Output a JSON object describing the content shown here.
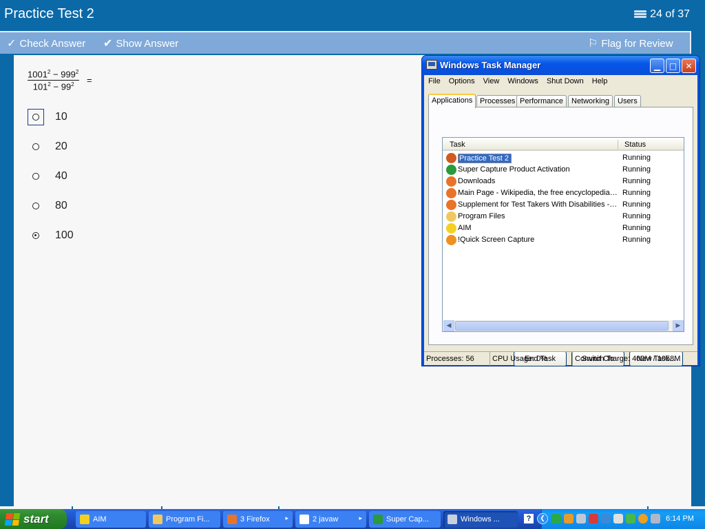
{
  "app": {
    "title": "Practice Test 2",
    "counter": "24 of 37",
    "toolbar": {
      "check_answer": "Check Answer",
      "show_answer": "Show Answer",
      "flag_review": "Flag for Review"
    }
  },
  "question": {
    "numerator": {
      "a": "1001",
      "exp_a": "2",
      "op": "−",
      "b": "999",
      "exp_b": "2"
    },
    "denominator": {
      "a": "101",
      "exp_a": "2",
      "op": "−",
      "b": "99",
      "exp_b": "2"
    },
    "equals": "=",
    "choices": [
      {
        "label": "10",
        "selected": false,
        "focused": true
      },
      {
        "label": "20",
        "selected": false
      },
      {
        "label": "40",
        "selected": false
      },
      {
        "label": "80",
        "selected": false
      },
      {
        "label": "100",
        "selected": true
      }
    ]
  },
  "task_manager": {
    "title": "Windows Task Manager",
    "menu": [
      "File",
      "Options",
      "View",
      "Windows",
      "Shut Down",
      "Help"
    ],
    "tabs": [
      "Applications",
      "Processes",
      "Performance",
      "Networking",
      "Users"
    ],
    "active_tab": "Applications",
    "columns": {
      "task": "Task",
      "status": "Status"
    },
    "tasks": [
      {
        "name": "Practice Test 2",
        "status": "Running",
        "icon": "java-icon",
        "selected": true
      },
      {
        "name": "Super Capture Product Activation",
        "status": "Running",
        "icon": "arrow-icon"
      },
      {
        "name": "Downloads",
        "status": "Running",
        "icon": "firefox-icon"
      },
      {
        "name": "Main Page - Wikipedia, the free encyclopedia ...",
        "status": "Running",
        "icon": "firefox-icon"
      },
      {
        "name": "Supplement for Test Takers With Disabilities - ...",
        "status": "Running",
        "icon": "firefox-icon"
      },
      {
        "name": "Program Files",
        "status": "Running",
        "icon": "folder-icon"
      },
      {
        "name": "AIM",
        "status": "Running",
        "icon": "aim-icon"
      },
      {
        "name": "!Quick Screen Capture",
        "status": "Running",
        "icon": "capture-icon"
      }
    ],
    "buttons": {
      "end_task": "End Task",
      "switch_to": "Switch To",
      "new_task": "New Task..."
    },
    "status_bar": {
      "processes": "Processes: 56",
      "cpu": "CPU Usage: 0%",
      "commit": "Commit Charge: 400M / 1058M"
    }
  },
  "taskbar": {
    "start_label": "start",
    "tasks": [
      {
        "label": "AIM",
        "icon": "aim-icon"
      },
      {
        "label": "Program Fi...",
        "icon": "folder-icon"
      },
      {
        "label": "3 Firefox",
        "icon": "firefox-icon",
        "group": true
      },
      {
        "label": "2 javaw",
        "icon": "window-icon",
        "group": true
      },
      {
        "label": "Super Cap...",
        "icon": "arrow-icon"
      },
      {
        "label": "Windows ...",
        "icon": "taskmgr-icon",
        "active": true
      }
    ],
    "help_glyph": "?",
    "clock": "6:14 PM"
  },
  "colors": {
    "accent_blue": "#0b69a8",
    "toolbar_blue": "#7fa9d9",
    "selection": "#316ac5",
    "xp_title": "#0656e8",
    "start_green": "#2f8b2f"
  }
}
